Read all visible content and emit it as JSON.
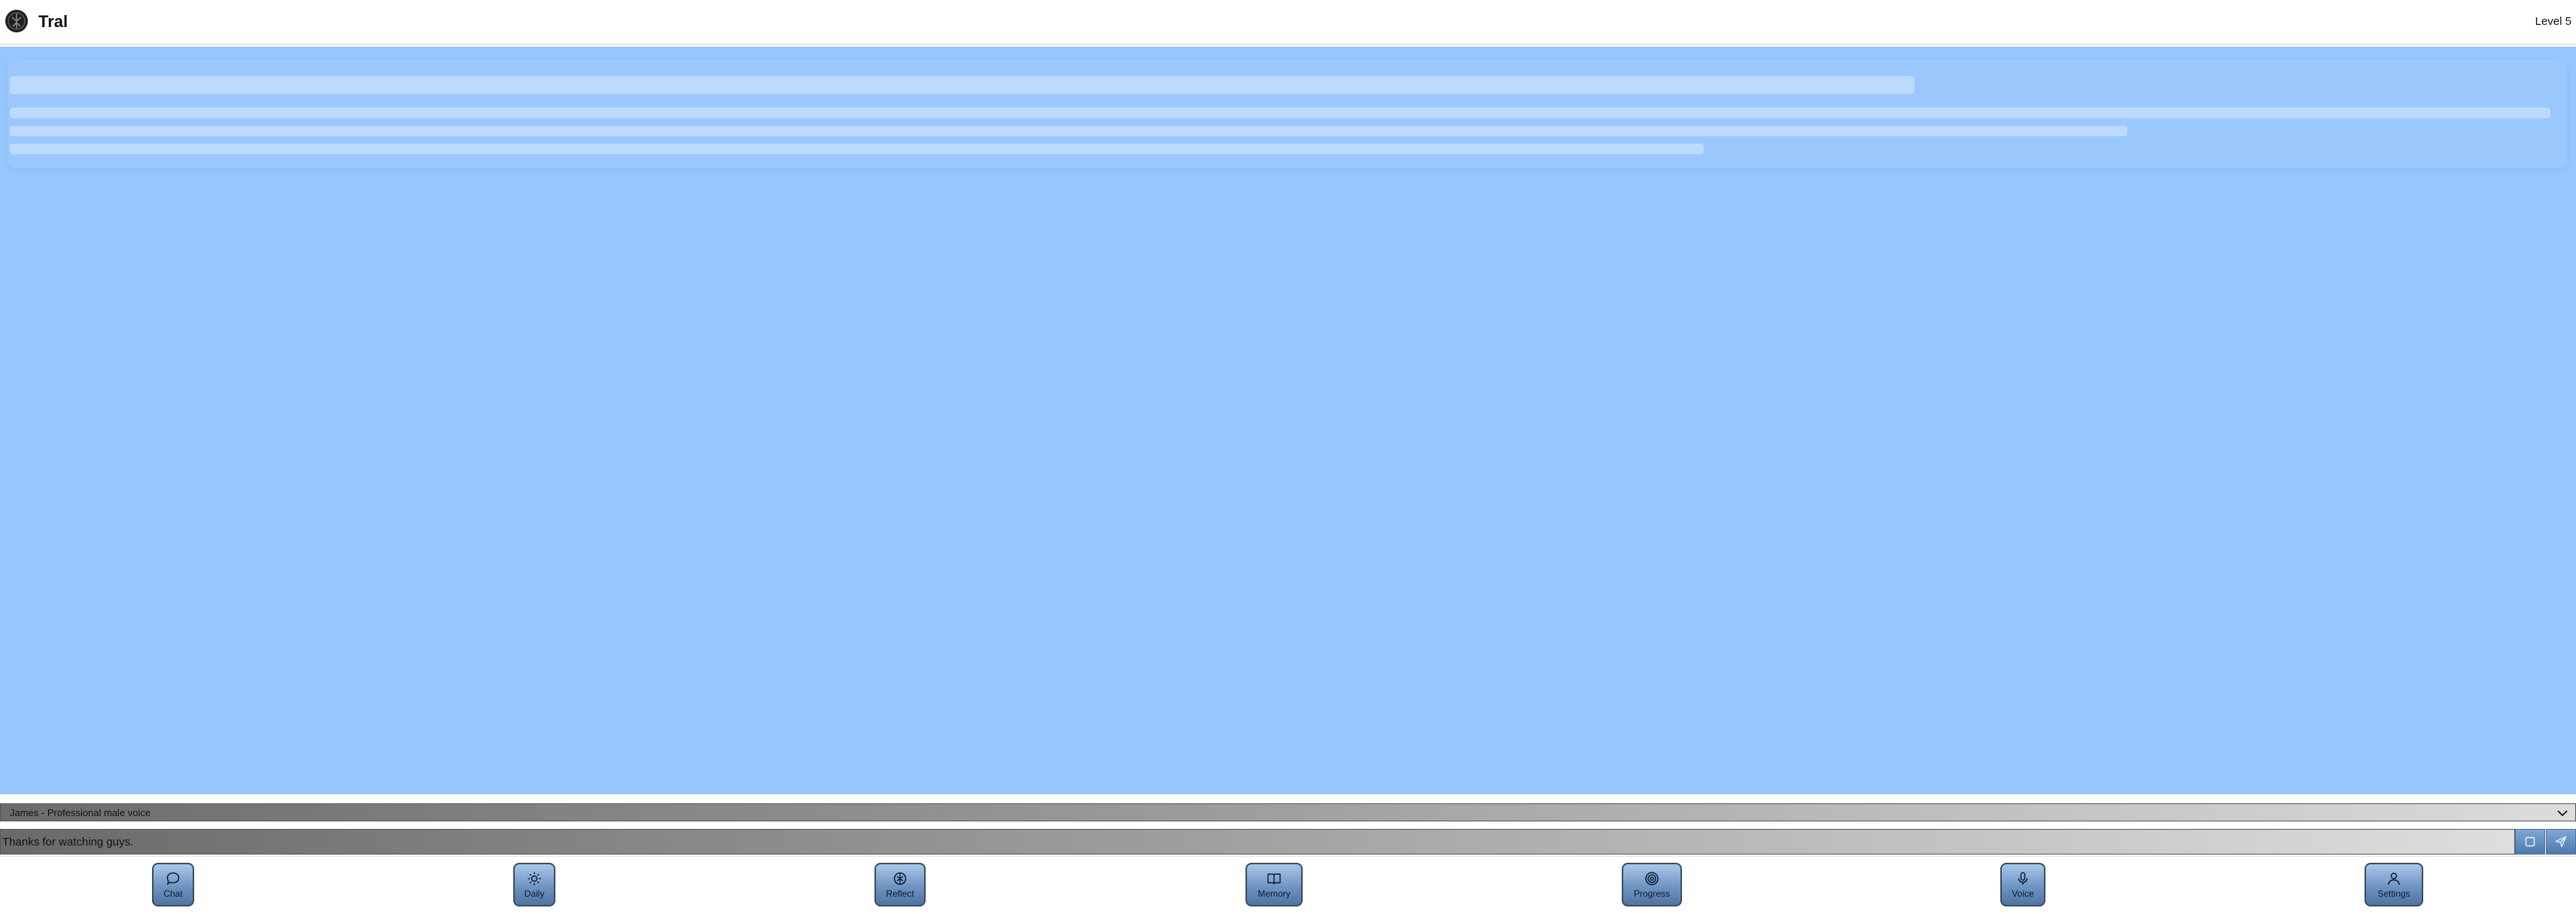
{
  "header": {
    "app_title": "Tral",
    "level": "Level 5"
  },
  "voice_select": {
    "selected": "James - Professional male voice"
  },
  "message_input": {
    "value": "Thanks for watching guys."
  },
  "nav": {
    "items": [
      {
        "label": "Chat",
        "icon": "chat-bubble-icon"
      },
      {
        "label": "Daily",
        "icon": "sun-icon"
      },
      {
        "label": "Reflect",
        "icon": "compass-icon"
      },
      {
        "label": "Memory",
        "icon": "book-icon"
      },
      {
        "label": "Progress",
        "icon": "target-icon"
      },
      {
        "label": "Voice",
        "icon": "microphone-icon"
      },
      {
        "label": "Settings",
        "icon": "user-icon"
      }
    ]
  },
  "colors": {
    "main_background": "#96c6fc",
    "button_accent": "#6f95c2"
  }
}
